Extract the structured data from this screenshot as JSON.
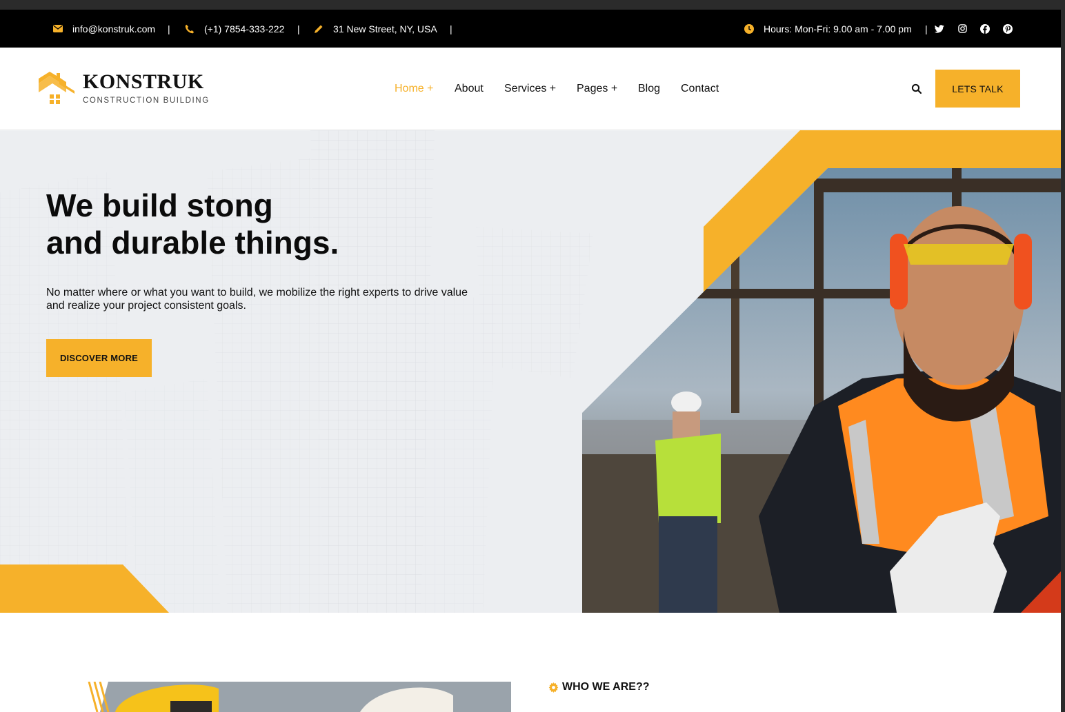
{
  "topbar": {
    "email": "info@konstruk.com",
    "phone": "(+1) 7854-333-222",
    "address": "31 New Street, NY, USA",
    "hours": "Hours: Mon-Fri: 9.00 am - 7.00 pm",
    "separator": "|",
    "icons": {
      "email": "envelope-icon",
      "phone": "phone-icon",
      "address": "pencil-icon",
      "hours": "clock-icon"
    },
    "social": [
      "twitter-icon",
      "instagram-icon",
      "facebook-icon",
      "pinterest-icon"
    ]
  },
  "header": {
    "logo_name": "KONSTRUK",
    "logo_sub": "CONSTRUCTION BUILDING",
    "nav": [
      {
        "label": "Home +",
        "active": true
      },
      {
        "label": "About",
        "active": false
      },
      {
        "label": "Services +",
        "active": false
      },
      {
        "label": "Pages +",
        "active": false
      },
      {
        "label": "Blog",
        "active": false
      },
      {
        "label": "Contact",
        "active": false
      }
    ],
    "search_icon": "search-icon",
    "cta": "LETS TALK"
  },
  "hero": {
    "title_line1": "We build stong",
    "title_line2": "and durable things.",
    "text": "No matter where or what you want to build, we mobilize the right experts to drive value and realize your project consistent goals.",
    "button": "DISCOVER MORE"
  },
  "about": {
    "label": "WHO WE ARE??",
    "label_icon": "gear-icon"
  },
  "colors": {
    "accent": "#f6b12a",
    "topbar_bg": "#000000",
    "hero_bg": "#eceef1",
    "text": "#111111"
  }
}
